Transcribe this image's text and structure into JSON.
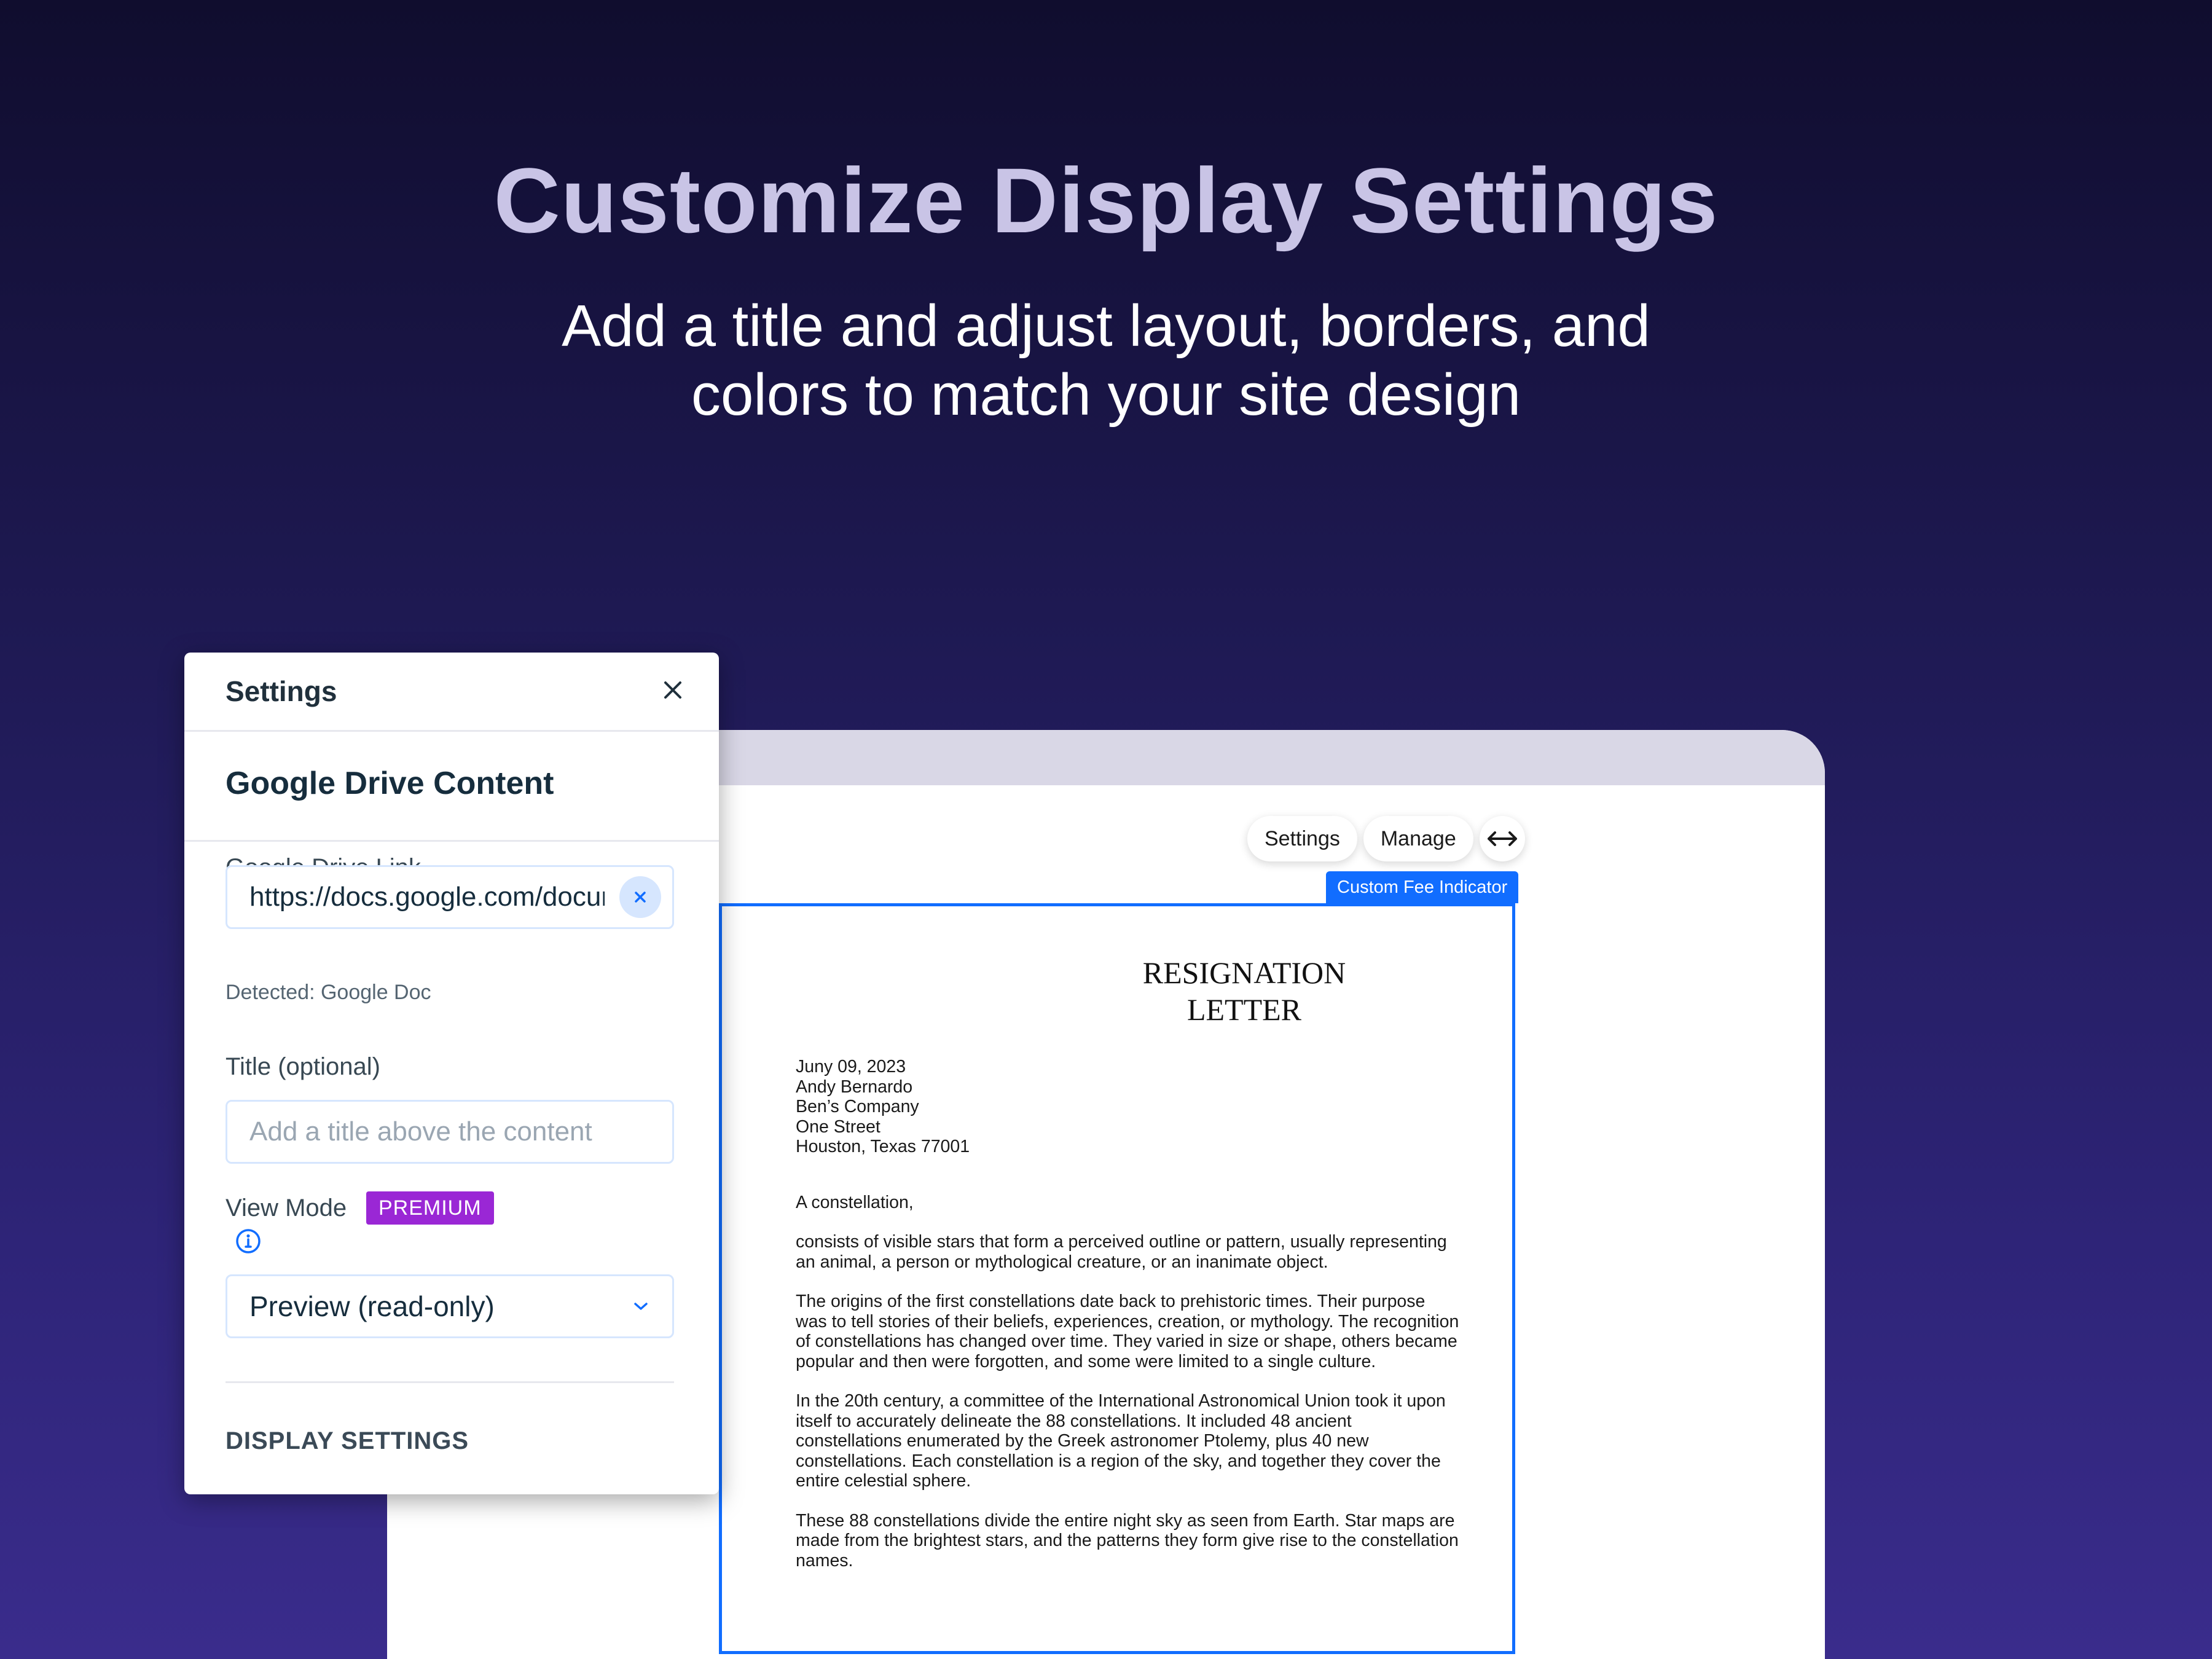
{
  "hero": {
    "title": "Customize Display Settings",
    "subtitle_line1": "Add a title and adjust layout, borders, and",
    "subtitle_line2": "colors to match your site design"
  },
  "editor": {
    "toolbar": {
      "settings_label": "Settings",
      "manage_label": "Manage",
      "stretch_icon": "horizontal-stretch-icon"
    },
    "element_tag": "Custom Fee Indicator",
    "document": {
      "title_line1": "RESIGNATION",
      "title_line2": "LETTER",
      "date": "Juny 09, 2023",
      "name": "Andy Bernardo",
      "company": "Ben’s Company",
      "street": "One Street",
      "city": "Houston, Texas 77001",
      "greeting": "A constellation,",
      "paragraphs": [
        "consists of visible stars that form a perceived outline or pattern, usually representing an animal, a person or mythological creature, or an inanimate object.",
        "The origins of the first constellations date back to prehistoric times. Their purpose was to tell stories of their beliefs, experiences, creation, or mythology. The recognition of constellations has changed over time. They varied in size or shape, others became popular and then were forgotten, and some were limited to a single culture.",
        "In the 20th century, a committee of the International Astronomical Union took it upon itself to accurately delineate the 88 constellations. It included 48 ancient constellations enumerated by the Greek astronomer Ptolemy, plus 40 new constellations. Each constellation is a region of the sky, and together they cover the entire celestial sphere.",
        "These 88 constellations divide the entire night sky as seen from Earth. Star maps are made from the brightest stars, and the patterns they form give rise to the constellation names."
      ]
    }
  },
  "panel": {
    "header_title": "Settings",
    "section_title": "Google Drive Content",
    "link_label": "Google Drive Link",
    "link_value": "https://docs.google.com/document/d",
    "detected": "Detected: Google Doc",
    "title_label": "Title (optional)",
    "title_placeholder": "Add a title above the content",
    "view_mode_label": "View Mode",
    "premium_badge": "PREMIUM",
    "view_mode_value": "Preview (read-only)",
    "display_settings": "DISPLAY SETTINGS"
  },
  "colors": {
    "accent": "#116dff",
    "premium": "#9a27d5"
  }
}
